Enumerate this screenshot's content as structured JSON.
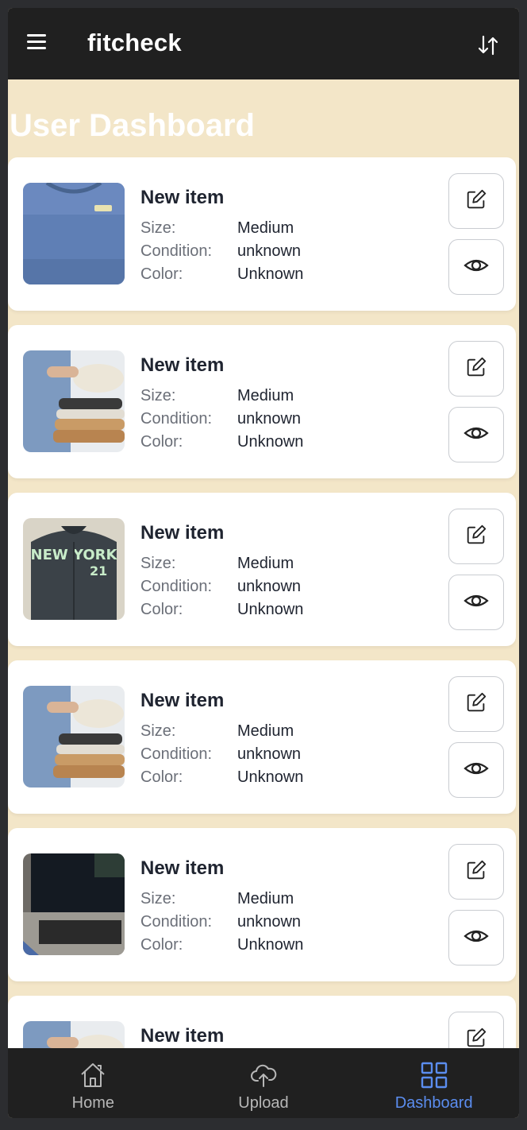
{
  "app": {
    "title": "fitcheck"
  },
  "dashboard": {
    "title": "User Dashboard"
  },
  "labels": {
    "size": "Size:",
    "condition": "Condition:",
    "color": "Color:"
  },
  "items": [
    {
      "name": "New item",
      "size": "Medium",
      "condition": "unknown",
      "color": "Unknown",
      "image": "blue-sweatshirt"
    },
    {
      "name": "New item",
      "size": "Medium",
      "condition": "unknown",
      "color": "Unknown",
      "image": "folded-clothes"
    },
    {
      "name": "New item",
      "size": "Medium",
      "condition": "unknown",
      "color": "Unknown",
      "image": "new-york-jacket"
    },
    {
      "name": "New item",
      "size": "Medium",
      "condition": "unknown",
      "color": "Unknown",
      "image": "folded-clothes"
    },
    {
      "name": "New item",
      "size": "Medium",
      "condition": "unknown",
      "color": "Unknown",
      "image": "laptop"
    },
    {
      "name": "New item",
      "size": "",
      "condition": "",
      "color": "",
      "image": "folded-clothes"
    }
  ],
  "nav": {
    "home": "Home",
    "upload": "Upload",
    "dashboard": "Dashboard",
    "active": "dashboard"
  },
  "icons": {
    "menu": "menu-icon",
    "sort": "sort-icon",
    "edit": "edit-icon",
    "view": "eye-icon",
    "home": "home-icon",
    "upload": "cloud-upload-icon",
    "dashboard": "grid-icon"
  },
  "colors": {
    "bar": "#202020",
    "background": "#f3e6c8",
    "accent": "#5b8def"
  }
}
